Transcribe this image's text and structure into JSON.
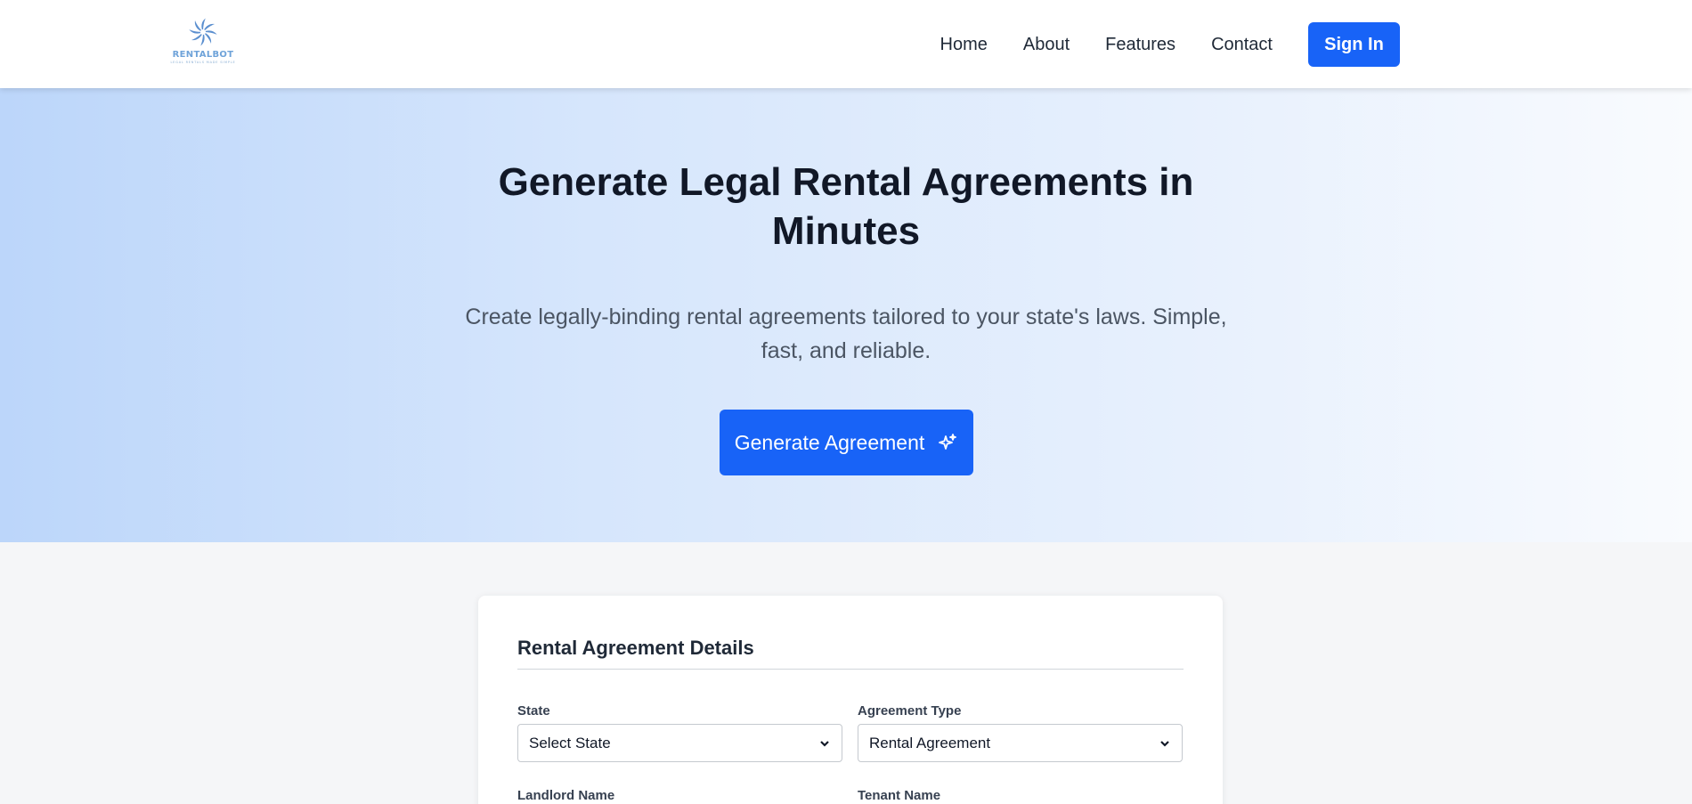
{
  "brand": {
    "name": "RENTALBOT",
    "tagline": "LEGAL RENTALS MADE SIMPLE",
    "accent": "#1863f7"
  },
  "nav": {
    "links": [
      "Home",
      "About",
      "Features",
      "Contact"
    ],
    "signin_label": "Sign In"
  },
  "hero": {
    "title": "Generate Legal Rental Agreements in Minutes",
    "subtitle": "Create legally-binding rental agreements tailored to your state's laws. Simple, fast, and reliable.",
    "cta_label": "Generate Agreement",
    "cta_icon": "sparkles-icon"
  },
  "form": {
    "title": "Rental Agreement Details",
    "fields": {
      "state": {
        "label": "State",
        "value": "Select State"
      },
      "agreement_type": {
        "label": "Agreement Type",
        "value": "Rental Agreement"
      },
      "landlord_name": {
        "label": "Landlord Name"
      },
      "tenant_name": {
        "label": "Tenant Name"
      }
    }
  }
}
